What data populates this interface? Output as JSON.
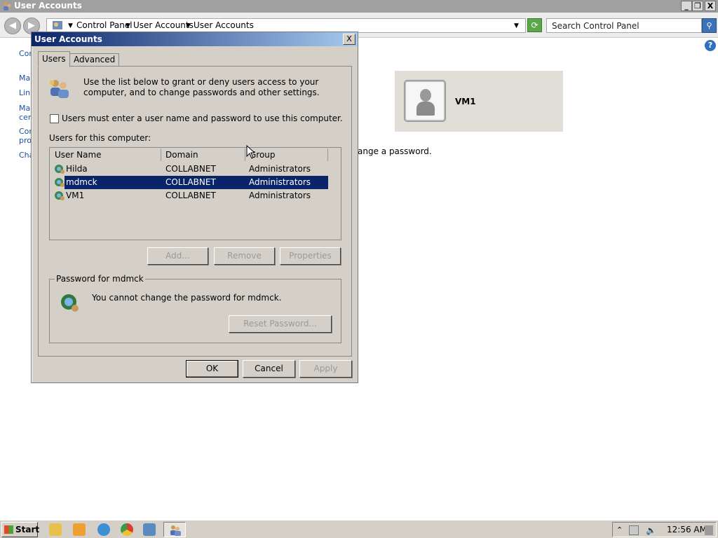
{
  "window": {
    "title": "User Accounts",
    "minimize_label": "_",
    "restore_label": "❐",
    "close_label": "X"
  },
  "nav": {
    "back_glyph": "◀",
    "forward_glyph": "▶",
    "breadcrumbs": [
      "Control Panel",
      "User Accounts",
      "User Accounts"
    ],
    "search_placeholder": "Search Control Panel",
    "refresh_glyph": "⟳",
    "search_glyph": "⚲"
  },
  "left_links": [
    "Cor",
    "Mar",
    "Link",
    "Mar cert",
    "Cor pro",
    "Cha"
  ],
  "help_glyph": "?",
  "user_panel": {
    "name": "VM1"
  },
  "background_text": "ange a password.",
  "dialog": {
    "title": "User Accounts",
    "close_label": "X",
    "tabs": [
      "Users",
      "Advanced"
    ],
    "intro": "Use the list below to grant or deny users access to your computer, and to change passwords and other settings.",
    "checkbox_label": "Users must enter a user name and password to use this computer.",
    "checkbox_checked": false,
    "list_label": "Users for this computer:",
    "columns": [
      "User Name",
      "Domain",
      "Group"
    ],
    "rows": [
      {
        "name": "Hilda",
        "domain": "COLLABNET",
        "group": "Administrators"
      },
      {
        "name": "mdmck",
        "domain": "COLLABNET",
        "group": "Administrators"
      },
      {
        "name": "VM1",
        "domain": "COLLABNET",
        "group": "Administrators"
      }
    ],
    "selected_row": "mdmck",
    "buttons": {
      "add": "Add...",
      "remove": "Remove",
      "properties": "Properties"
    },
    "password_group": {
      "legend": "Password for mdmck",
      "message": "You cannot change the password for mdmck.",
      "reset_label": "Reset Password..."
    },
    "footer": {
      "ok": "OK",
      "cancel": "Cancel",
      "apply": "Apply"
    }
  },
  "taskbar": {
    "start_label": "Start",
    "clock": "12:56 AM"
  },
  "colors": {
    "selection": "#0a246a",
    "dialog_bg": "#d4d0c8",
    "link": "#1a4fa0"
  }
}
